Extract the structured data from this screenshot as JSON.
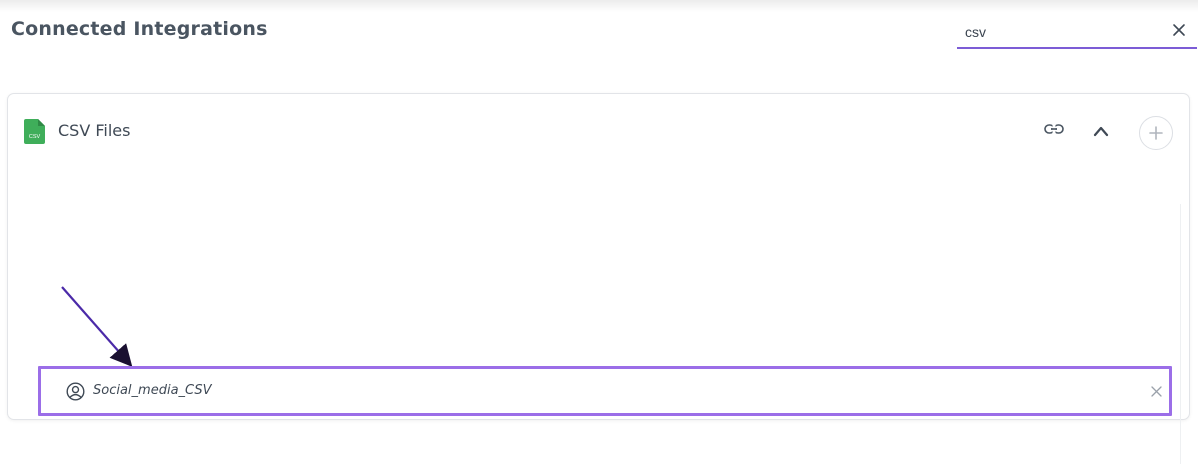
{
  "page": {
    "title": "Connected Integrations"
  },
  "search": {
    "value": "csv",
    "clear_icon": "close-icon"
  },
  "integration_card": {
    "title": "CSV Files",
    "icon": "csv-file-icon",
    "icon_text": "CSV",
    "icon_color": "#3fae5a",
    "actions": {
      "link_icon": "link-icon",
      "collapse_icon": "chevron-up-icon",
      "add_icon": "plus-icon"
    },
    "items": [
      {
        "label": "Social_media_CSV",
        "icon": "user-circle-icon",
        "remove_icon": "close-icon"
      }
    ]
  },
  "colors": {
    "accent": "#7c5cd6",
    "highlight_border": "#9b6ee8",
    "arrow": "#4b2aa8"
  }
}
